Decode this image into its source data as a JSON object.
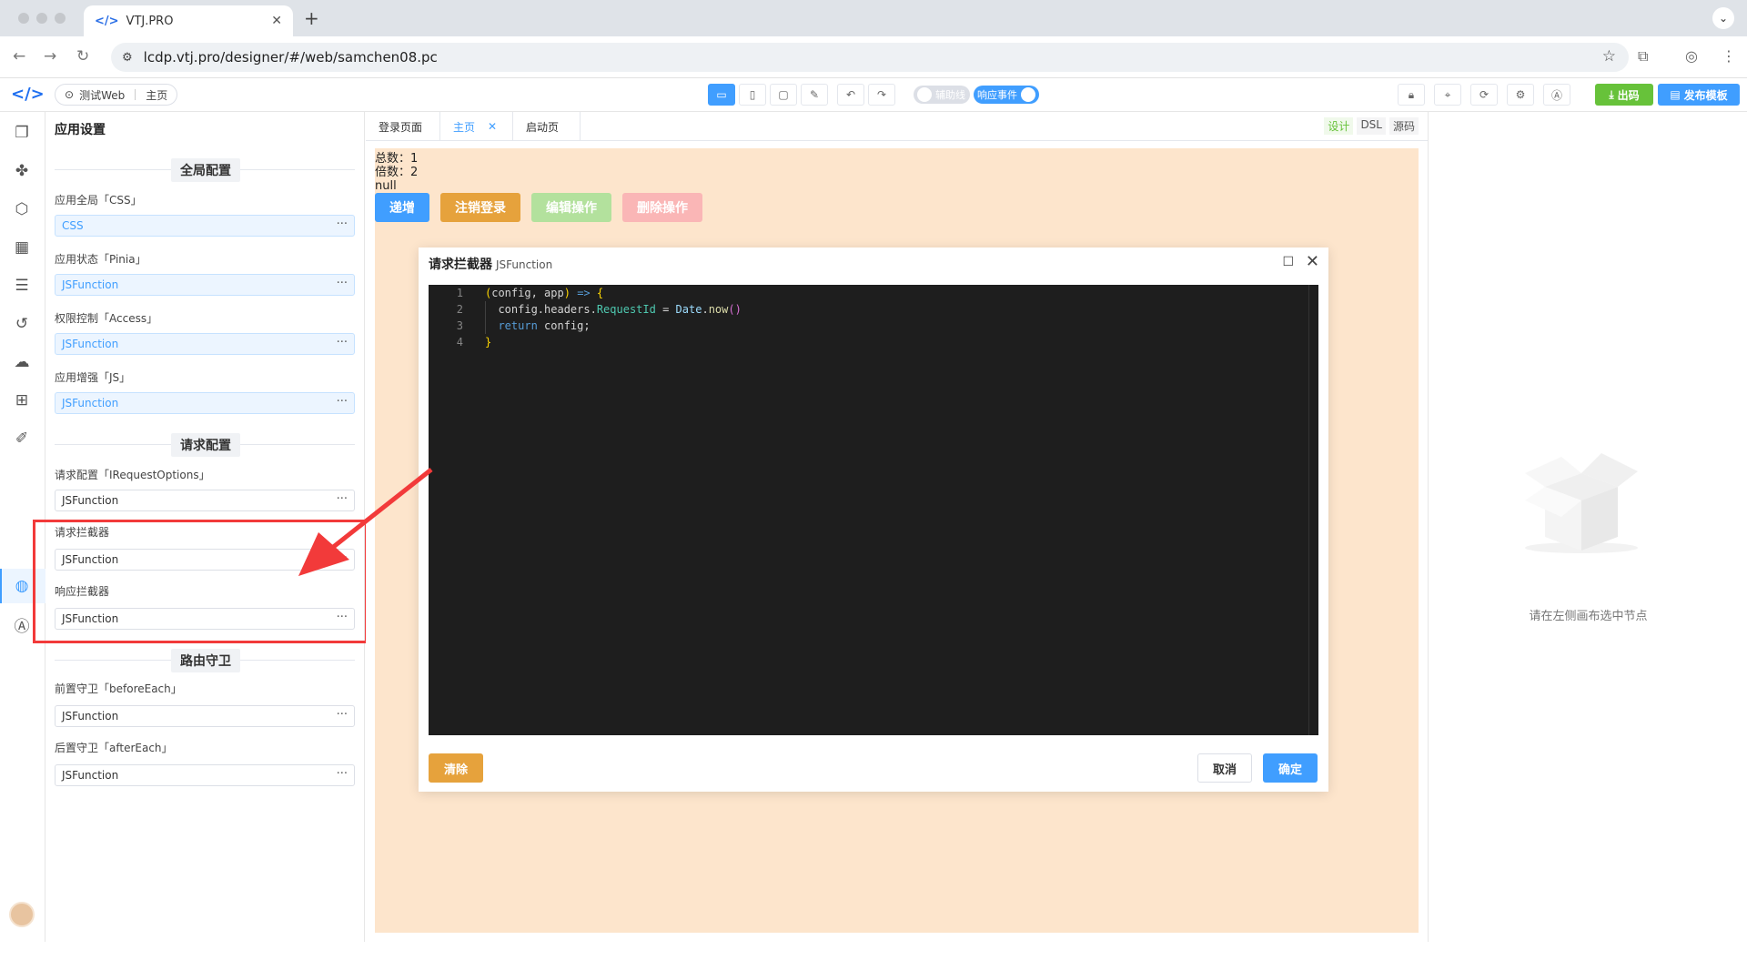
{
  "browser": {
    "tab_title": "VTJ.PRO",
    "tab_close": "✕",
    "new_tab": "+",
    "url": "lcdp.vtj.pro/designer/#/web/samchen08.pc"
  },
  "toolbar": {
    "breadcrumb_project": "测试Web",
    "breadcrumb_page": "主页",
    "switch_guides": "辅助线",
    "switch_events": "响应事件",
    "export_label": "出码",
    "publish_label": "发布模板"
  },
  "panel": {
    "title": "应用设置",
    "section_global": "全局配置",
    "section_request": "请求配置",
    "section_router": "路由守卫",
    "fields": [
      {
        "label": "应用全局「CSS」",
        "value": "CSS"
      },
      {
        "label": "应用状态「Pinia」",
        "value": "JSFunction"
      },
      {
        "label": "权限控制「Access」",
        "value": "JSFunction"
      },
      {
        "label": "应用增强「JS」",
        "value": "JSFunction"
      },
      {
        "label": "请求配置「IRequestOptions」",
        "value": "JSFunction"
      },
      {
        "label": "请求拦截器",
        "value": "JSFunction"
      },
      {
        "label": "响应拦截器",
        "value": "JSFunction"
      },
      {
        "label": "前置守卫「beforeEach」",
        "value": "JSFunction"
      },
      {
        "label": "后置守卫「afterEach」",
        "value": "JSFunction"
      }
    ],
    "more": "···"
  },
  "canvas": {
    "tabs": [
      "登录页面",
      "主页",
      "启动页"
    ],
    "view_modes": [
      "设计",
      "DSL",
      "源码"
    ],
    "text_lines": [
      "总数：1",
      "倍数：2",
      "null"
    ],
    "buttons": [
      {
        "label": "递增",
        "color": "#409eff"
      },
      {
        "label": "注销登录",
        "color": "#e6a23c"
      },
      {
        "label": "编辑操作",
        "color": "#b3e19d"
      },
      {
        "label": "删除操作",
        "color": "#fab6b6"
      }
    ]
  },
  "dialog": {
    "title": "请求拦截器",
    "subtitle": "JSFunction",
    "line_numbers": [
      "1",
      "2",
      "3",
      "4"
    ],
    "clear_label": "清除",
    "cancel_label": "取消",
    "confirm_label": "确定"
  },
  "right_panel": {
    "empty_text": "请在左侧画布选中节点"
  },
  "colors": {
    "accent": "#409eff",
    "success": "#67c23a",
    "warning": "#e6a23c",
    "annotation": "#f23a3a",
    "canvas_bg": "#fde5cc"
  }
}
